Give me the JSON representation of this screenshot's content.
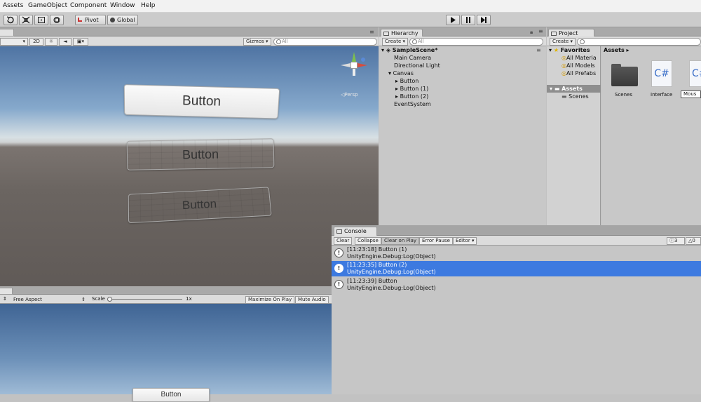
{
  "menu": [
    "Assets",
    "GameObject",
    "Component",
    "Window",
    "Help"
  ],
  "toolbar": {
    "pivot_label": "Pivot",
    "global_label": "Global"
  },
  "scene": {
    "mode_2d": "2D",
    "gizmos_label": "Gizmos",
    "search_placeholder": "All",
    "button1": "Button",
    "button2": "Button",
    "button3": "Button",
    "persp_label": "◁Persp"
  },
  "hierarchy": {
    "tab_label": "Hierarchy",
    "create_label": "Create",
    "search_placeholder": "All",
    "scene_name": "SampleScene*",
    "items": [
      "Main Camera",
      "Directional Light",
      "Canvas",
      "Button",
      "Button (1)",
      "Button (2)",
      "EventSystem"
    ]
  },
  "project": {
    "tab_label": "Project",
    "create_label": "Create",
    "favorites_label": "Favorites",
    "favorites": [
      "All Materia",
      "All Models",
      "All Prefabs"
    ],
    "assets_label": "Assets",
    "assets_tree": [
      "Scenes"
    ],
    "breadcrumb": "Assets",
    "grid": [
      {
        "name": "Scenes",
        "icon": "folder-icon"
      },
      {
        "name": "Interface",
        "icon": "csharp-script-icon"
      },
      {
        "name": "Mous",
        "icon": "csharp-script-icon"
      }
    ]
  },
  "game": {
    "aspect_label": "Free Aspect",
    "scale_label": "Scale",
    "scale_value": "1x",
    "maximize_label": "Maximize On Play",
    "mute_label": "Mute Audio",
    "bottom_button": "Button"
  },
  "console": {
    "tab_label": "Console",
    "buttons": [
      "Clear",
      "Collapse",
      "Clear on Play",
      "Error Pause",
      "Editor"
    ],
    "count_warn": "3",
    "count_err": "0",
    "rows": [
      {
        "line1": "[11:23:18] Button (1)",
        "line2": "UnityEngine.Debug:Log(Object)",
        "selected": false
      },
      {
        "line1": "[11:23:35] Button (2)",
        "line2": "UnityEngine.Debug:Log(Object)",
        "selected": true
      },
      {
        "line1": "[11:23:39] Button",
        "line2": "UnityEngine.Debug:Log(Object)",
        "selected": false
      }
    ]
  },
  "colors": {
    "selection": "#3d7ae0",
    "sky_top": "#5c80ad",
    "ground": "#6b6561"
  }
}
